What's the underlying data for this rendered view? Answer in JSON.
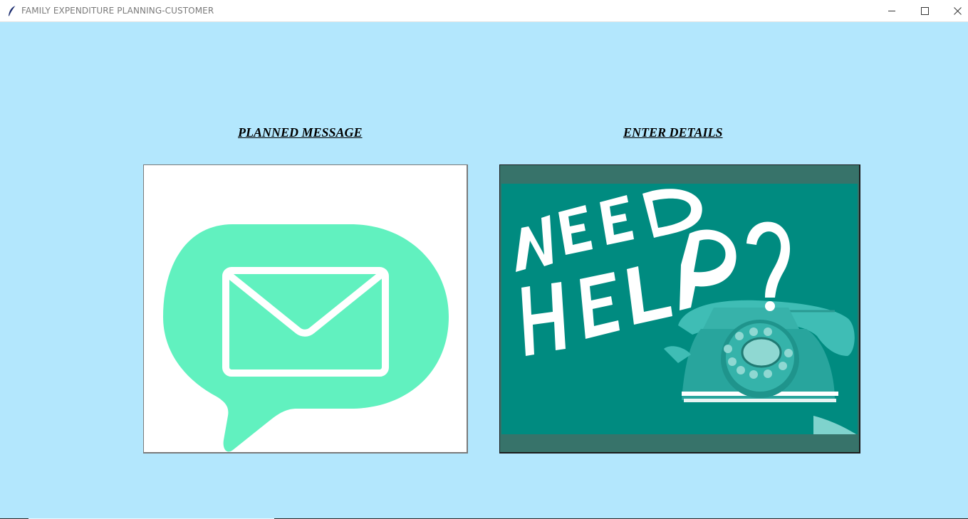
{
  "window": {
    "title": "FAMILY EXPENDITURE PLANNING-CUSTOMER",
    "app_icon": "feather-icon",
    "controls": [
      "minimize-icon",
      "maximize-icon",
      "close-icon"
    ]
  },
  "options": {
    "planned_message": {
      "label": "PLANNED MESSAGE",
      "image_icon": "envelope-chat-bubble-icon"
    },
    "enter_details": {
      "label": "ENTER DETAILS",
      "image_icon": "need-help-telephone-image",
      "image_text": "NEED HELP?"
    }
  },
  "colors": {
    "background": "#b3e7fd",
    "bubble": "#61f1bf",
    "help_teal": "#008b80",
    "help_border": "#37736a"
  }
}
